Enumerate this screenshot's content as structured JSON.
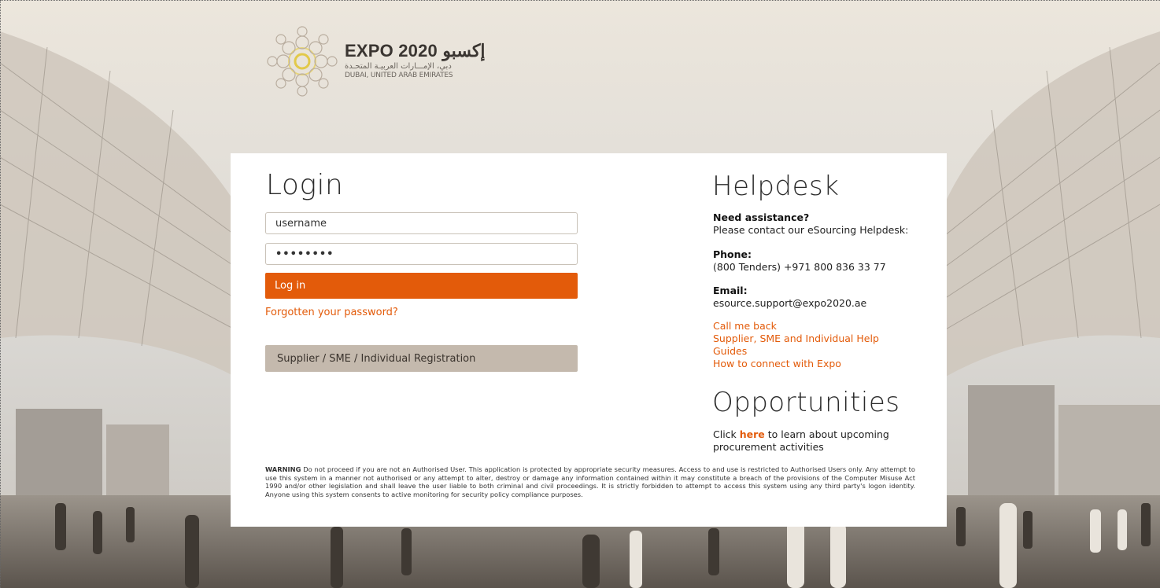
{
  "logo": {
    "line1": "EXPO 2020 إكسبو",
    "line2": "دبي، الإمـــارات العربيـة المتحـدة",
    "line3": "DUBAI, UNITED ARAB EMIRATES"
  },
  "login": {
    "title": "Login",
    "username_value": "username",
    "password_value": "••••••••",
    "login_button": "Log in",
    "forgot_link": "Forgotten your password?",
    "registration_button": "Supplier / SME / Individual Registration"
  },
  "helpdesk": {
    "title": "Helpdesk",
    "need_label": "Need assistance?",
    "need_text": "Please contact our eSourcing Helpdesk:",
    "phone_label": "Phone:",
    "phone_value": "(800 Tenders) +971 800 836 33 77",
    "email_label": "Email:",
    "email_value": "esource.support@expo2020.ae",
    "links": [
      "Call me back",
      "Supplier, SME and Individual Help Guides",
      "How to connect with Expo"
    ]
  },
  "opportunities": {
    "title": "Opportunities",
    "text_before": "Click ",
    "link": "here",
    "text_after": " to learn about upcoming procurement activities"
  },
  "warning": {
    "label": "WARNING",
    "text": " Do not proceed if you are not an Authorised User. This application is protected by appropriate security measures. Access to and use is restricted to Authorised Users only. Any attempt to use this system in a manner not authorised or any attempt to alter, destroy or damage any information contained within it may constitute a breach of the provisions of the Computer Misuse Act 1990 and/or other legislation and shall leave the user liable to both criminal and civil proceedings. It is strictly forbidden to attempt to access this system using any third party's logon identity. Anyone using this system consents to active monitoring for security policy compliance purposes."
  },
  "colors": {
    "accent": "#e35b0a",
    "registration_button": "#c4b9ad",
    "panel": "#ffffff"
  }
}
